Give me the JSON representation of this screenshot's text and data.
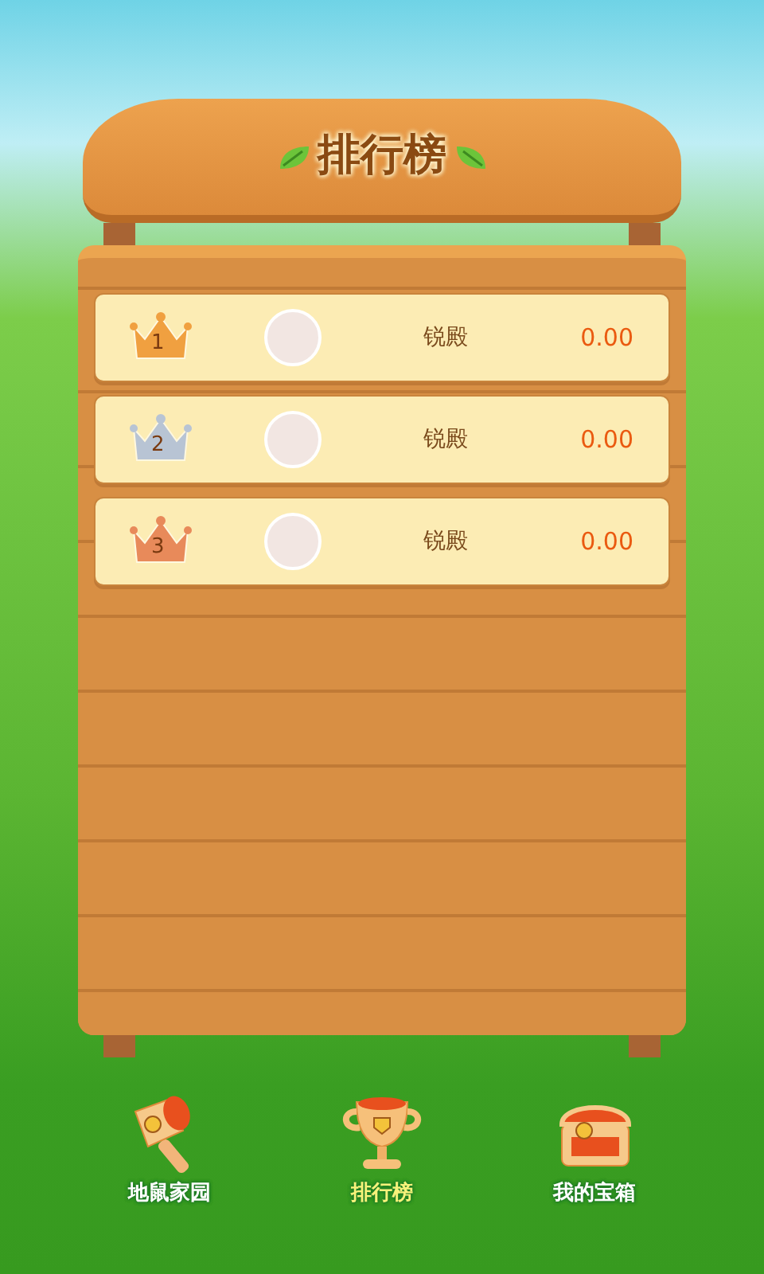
{
  "title": "排行榜",
  "rows": [
    {
      "rank": "1",
      "color": "#f0a040",
      "name": "锐殿",
      "score": "0.00"
    },
    {
      "rank": "2",
      "color": "#b8c4d4",
      "name": "锐殿",
      "score": "0.00"
    },
    {
      "rank": "3",
      "color": "#e88a5a",
      "name": "锐殿",
      "score": "0.00"
    }
  ],
  "nav": [
    {
      "kind": "hammer",
      "label": "地鼠家园",
      "selected": false
    },
    {
      "kind": "trophy",
      "label": "排行榜",
      "selected": true
    },
    {
      "kind": "chest",
      "label": "我的宝箱",
      "selected": false
    }
  ]
}
